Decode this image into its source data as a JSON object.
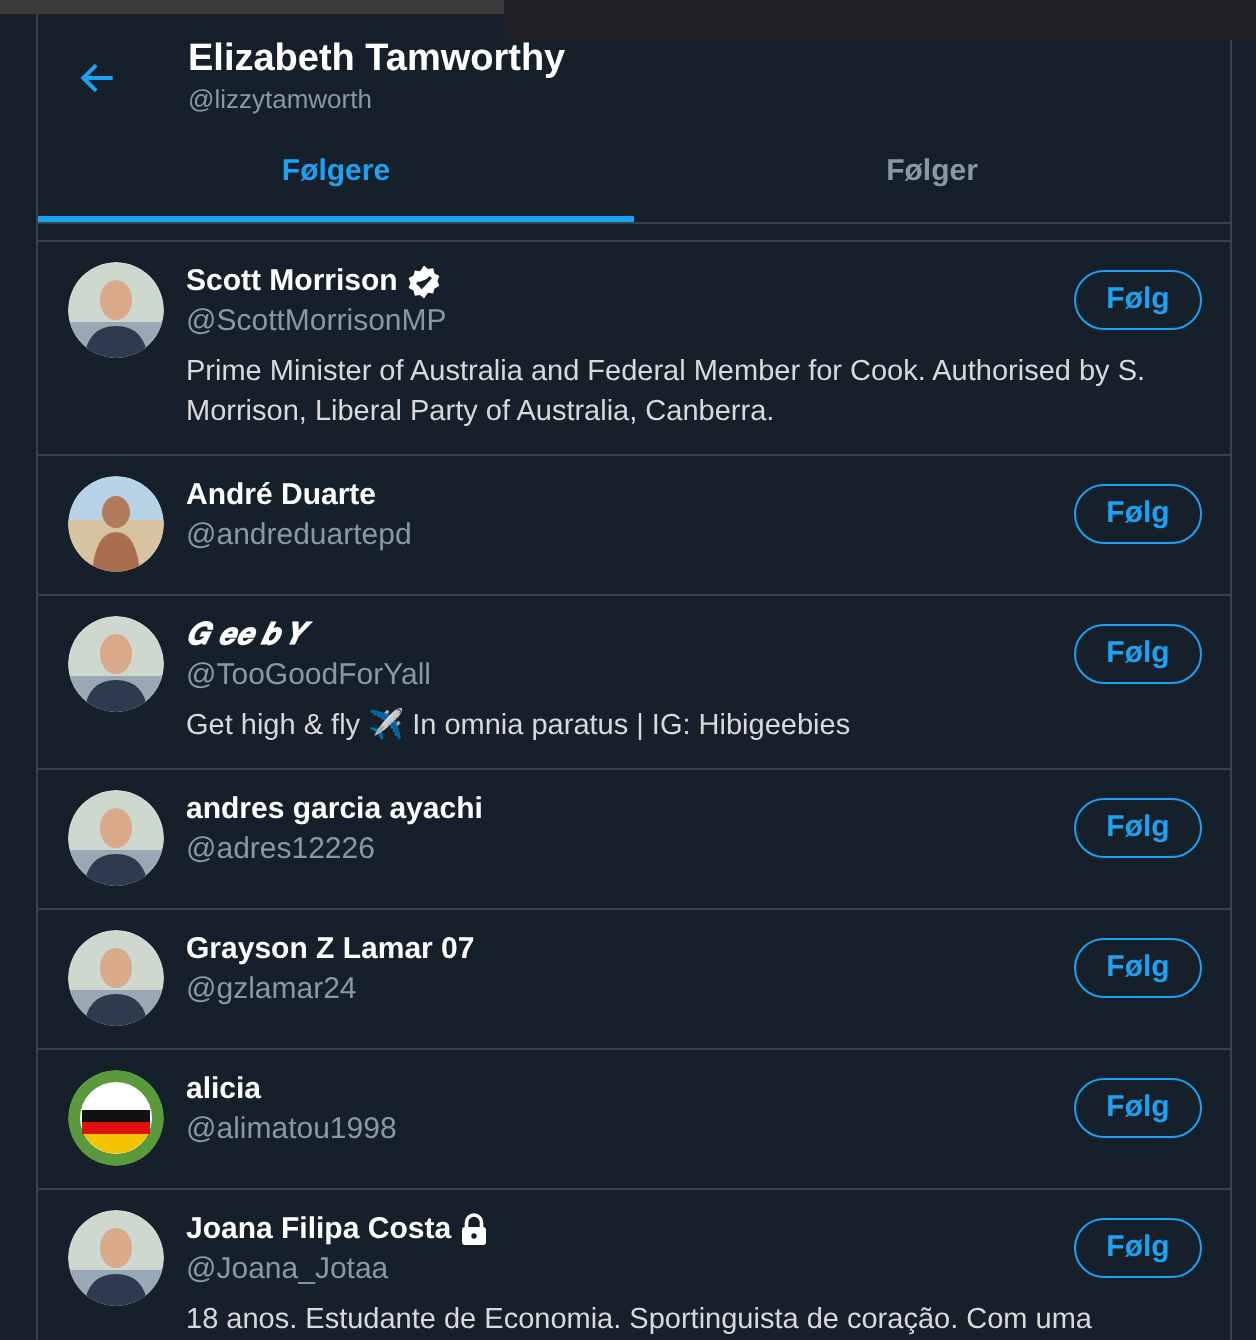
{
  "header": {
    "name": "Elizabeth Tamworthy",
    "handle": "@lizzytamworth"
  },
  "tabs": [
    {
      "label": "Følgere",
      "selected": true
    },
    {
      "label": "Følger",
      "selected": false
    }
  ],
  "users": [
    {
      "name": "Scott Morrison",
      "verified": true,
      "protected": false,
      "fancy": false,
      "handle": "@ScottMorrisonMP",
      "bio": "Prime Minister of Australia and Federal Member for Cook. Authorised by S. Morrison, Liberal Party of Australia, Canberra.",
      "button": "Følg"
    },
    {
      "name": "André Duarte",
      "verified": false,
      "protected": false,
      "fancy": false,
      "handle": "@andreduartepd",
      "button": "Følg"
    },
    {
      "name": "𝑮 𝒆𝒆 𝒃 𝒀",
      "verified": false,
      "protected": false,
      "fancy": true,
      "handle": "@TooGoodForYall",
      "bio": "Get high & fly ✈️ In omnia paratus | IG: Hibigeebies",
      "button": "Følg"
    },
    {
      "name": "andres garcia ayachi",
      "verified": false,
      "protected": false,
      "fancy": false,
      "handle": "@adres12226",
      "button": "Følg"
    },
    {
      "name": "Grayson Z Lamar 07",
      "verified": false,
      "protected": false,
      "fancy": false,
      "handle": "@gzlamar24",
      "button": "Følg"
    },
    {
      "name": "alicia",
      "verified": false,
      "protected": false,
      "fancy": false,
      "handle": "@alimatou1998",
      "button": "Følg"
    },
    {
      "name": "Joana Filipa Costa",
      "verified": false,
      "protected": true,
      "fancy": false,
      "handle": "@Joana_Jotaa",
      "bio": "18 anos. Estudante de Economia. Sportinguista de coração. Com uma",
      "button": "Følg"
    }
  ]
}
